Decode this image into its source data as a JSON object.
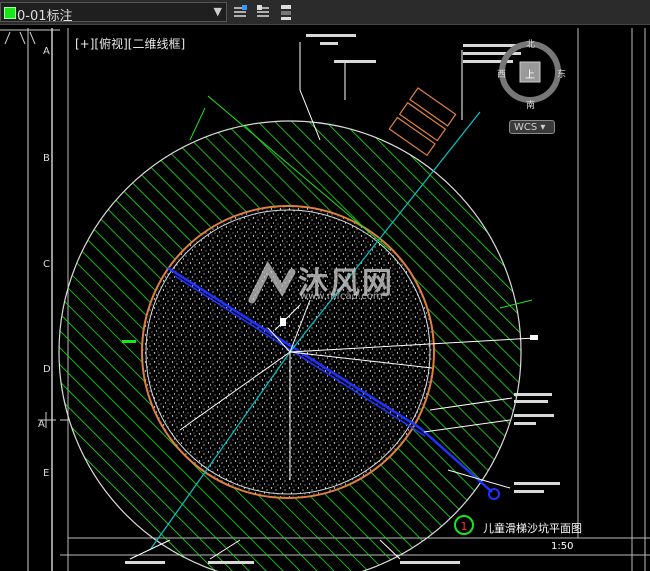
{
  "toolbar": {
    "layer_name": "0-01标注",
    "layer_color": "#19e619",
    "icons": [
      "layer-properties-icon",
      "layer-state-icon",
      "layer-isolate-icon"
    ]
  },
  "viewport": {
    "view_label": "[+][俯视][二维线框]",
    "grid_labels": [
      "A",
      "B",
      "C",
      "D",
      "A",
      "E"
    ],
    "viewcube": {
      "north": "北",
      "south": "南",
      "west": "西",
      "east": "东",
      "top": "上"
    },
    "wcs_label": "WCS",
    "watermark": {
      "brand": "沐风网",
      "url": "www.mfcad.com"
    },
    "plan_number": "1",
    "plan_title": "儿童滑梯沙坑平面图",
    "plan_scale": "1:50"
  },
  "colors": {
    "hatch": "#19e619",
    "sand": "#ffffff",
    "outline": "#d9d9d9",
    "pipe": "#1f33ff",
    "axis": "#00c8c8",
    "rim": "#e08040"
  }
}
